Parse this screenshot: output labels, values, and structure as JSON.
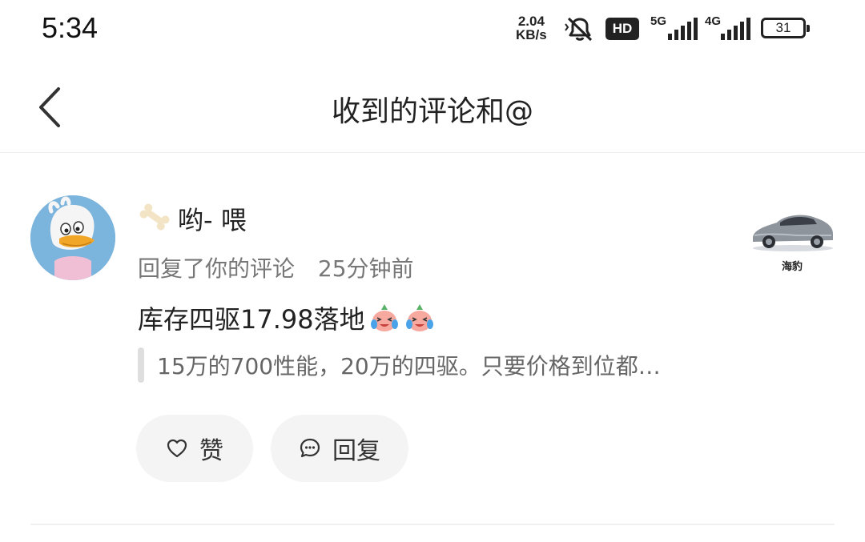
{
  "status_bar": {
    "time": "5:34",
    "speed_value": "2.04",
    "speed_unit": "KB/s",
    "hd_label": "HD",
    "network_1": "5G",
    "network_2": "4G",
    "battery": "31"
  },
  "header": {
    "title": "收到的评论和@",
    "back_icon": "chevron-left-icon"
  },
  "notification": {
    "username": "哟- 喂",
    "action": "回复了你的评论",
    "time": "25分钟前",
    "comment": "库存四驱17.98落地",
    "emoji_icon": "crying-laughing-emoji",
    "quoted_text": "15万的700性能，20万的四驱。只要价格到位都…",
    "thumbnail_caption": "海豹",
    "like_label": "赞",
    "reply_label": "回复"
  },
  "colors": {
    "background": "#ffffff",
    "text_primary": "#222222",
    "text_secondary": "#777777",
    "pill_background": "#f4f4f4",
    "avatar_background": "#7bb4dc"
  }
}
